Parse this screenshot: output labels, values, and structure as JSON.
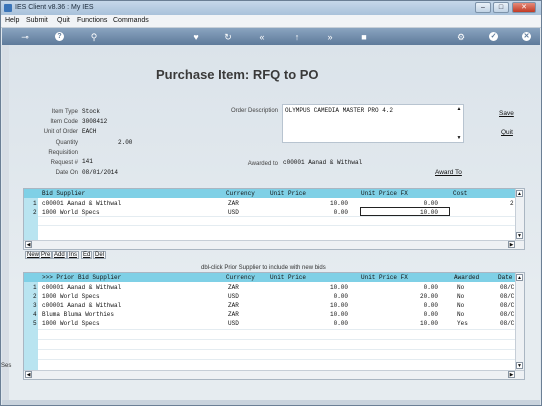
{
  "window": {
    "title": "IES Client v8.36 : My IES"
  },
  "menu": [
    "Help",
    "Submit",
    "Quit",
    "Functions",
    "Commands"
  ],
  "form": {
    "title": "Purchase Item: RFQ to PO",
    "fields": {
      "item_type": {
        "label": "Item Type",
        "value": "Stock"
      },
      "item_code": {
        "label": "Item Code",
        "value": "3008412"
      },
      "unit_of_order": {
        "label": "Unit of Order",
        "value": "EACH"
      },
      "quantity": {
        "label": "Quantity",
        "value": "2.00"
      },
      "requisition": {
        "label": "Requisition",
        "value": ""
      },
      "request_no": {
        "label": "Request #",
        "value": "141"
      },
      "date_on": {
        "label": "Date On",
        "value": "08/01/2014"
      },
      "order_description": {
        "label": "Order Description",
        "value": "OLYMPUS CAMEDIA MASTER PRO 4.2"
      },
      "awarded_to": {
        "label": "Awarded to",
        "value": "c00001 Aanad & Withwal"
      }
    },
    "links": {
      "save": "Save",
      "quit": "Quit",
      "award_to": "Award To"
    }
  },
  "bids": {
    "columns": [
      "Bid Supplier",
      "Currency",
      "Unit Price",
      "Unit Price FX",
      "Cost"
    ],
    "rows": [
      {
        "n": "1",
        "supplier": "c00001 Aanad & Withwal",
        "currency": "ZAR",
        "unit_price": "10.00",
        "unit_price_fx": "0.00",
        "cost": "2"
      },
      {
        "n": "2",
        "supplier": "1000 World Specs",
        "currency": "USD",
        "unit_price": "0.00",
        "unit_price_fx": "10.00",
        "cost": ""
      }
    ]
  },
  "nav_buttons": [
    "New",
    "Pre",
    "Add",
    "Ins",
    "Ed",
    "Del"
  ],
  "hint": "dbl-click Prior Supplier to include with new bids",
  "prior": {
    "columns": [
      ">>> Prior Bid Supplier",
      "Currency",
      "Unit Price",
      "Unit Price FX",
      "Awarded",
      "Date"
    ],
    "rows": [
      {
        "n": "1",
        "supplier": "c00001 Aanad & Withwal",
        "currency": "ZAR",
        "unit_price": "10.00",
        "unit_price_fx": "0.00",
        "awarded": "No",
        "date": "08/C"
      },
      {
        "n": "2",
        "supplier": "1000 World Specs",
        "currency": "USD",
        "unit_price": "0.00",
        "unit_price_fx": "20.00",
        "awarded": "No",
        "date": "08/C"
      },
      {
        "n": "3",
        "supplier": "c00001 Aanad & Withwal",
        "currency": "ZAR",
        "unit_price": "10.00",
        "unit_price_fx": "0.00",
        "awarded": "No",
        "date": "08/C"
      },
      {
        "n": "4",
        "supplier": "Bluma Bluma Worthies",
        "currency": "ZAR",
        "unit_price": "10.00",
        "unit_price_fx": "0.00",
        "awarded": "No",
        "date": "08/C"
      },
      {
        "n": "5",
        "supplier": "1000 World Specs",
        "currency": "USD",
        "unit_price": "0.00",
        "unit_price_fx": "10.00",
        "awarded": "Yes",
        "date": "08/C"
      }
    ]
  },
  "side_label": "Ses"
}
